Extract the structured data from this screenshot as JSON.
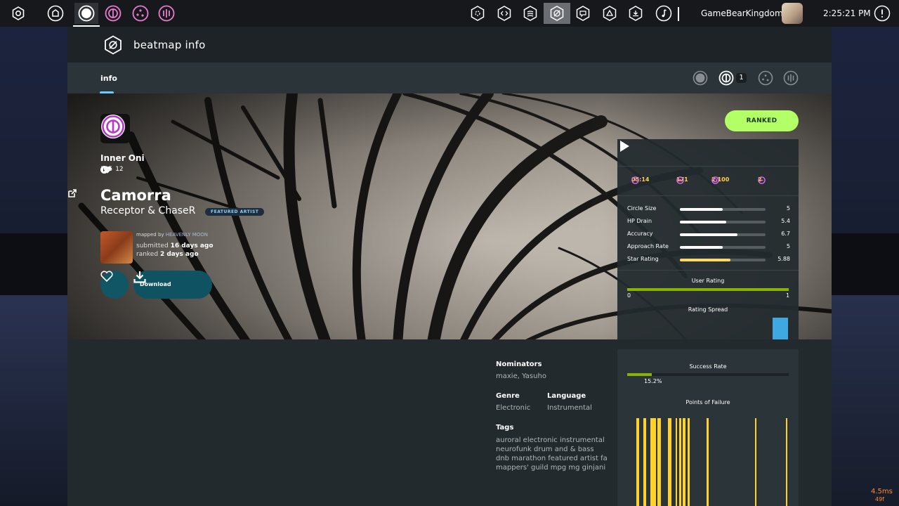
{
  "toolbar": {
    "user": "GameBearKingdom",
    "clock": "2:25:21 PM",
    "left_buttons": [
      "settings-icon",
      "home-icon",
      "osu-ruleset-icon",
      "taiko-ruleset-icon",
      "catch-ruleset-icon",
      "mania-ruleset-icon"
    ],
    "right_buttons": [
      "news-icon",
      "changelog-icon",
      "rankings-icon",
      "beatmap-listing-icon",
      "chat-icon",
      "notifications-icon",
      "wiki-icon",
      "music-icon"
    ]
  },
  "overlay": {
    "title": "beatmap info",
    "tab": "info",
    "ruleset_count": "1",
    "status": "RANKED"
  },
  "beatmap": {
    "difficulty_name": "Inner Oni",
    "play_count": "105",
    "favourite_count": "12",
    "title": "Camorra",
    "artist": "Receptor & ChaseR",
    "featured_label": "FEATURED ARTIST",
    "mapped_by_label": "mapped by",
    "mapper": "HEAVENLY MOON",
    "submitted_label": "submitted",
    "submitted_ago": "16 days ago",
    "ranked_label": "ranked",
    "ranked_ago": "2 days ago",
    "download_label": "Download"
  },
  "stats": {
    "length": "05:14",
    "bpm": "171",
    "circles": "2,100",
    "sliders": "2"
  },
  "attributes": [
    {
      "label": "Circle Size",
      "value": "5",
      "fraction": 0.5
    },
    {
      "label": "HP Drain",
      "value": "5.4",
      "fraction": 0.54
    },
    {
      "label": "Accuracy",
      "value": "6.7",
      "fraction": 0.67
    },
    {
      "label": "Approach Rate",
      "value": "5",
      "fraction": 0.5
    },
    {
      "label": "Star Rating",
      "value": "5.88",
      "fraction": 0.588
    }
  ],
  "user_rating": {
    "title": "User Rating",
    "min": "0",
    "max": "1",
    "spread_title": "Rating Spread"
  },
  "details": {
    "nominators_title": "Nominators",
    "nominators": "maxie, Yasuho",
    "genre_title": "Genre",
    "genre": "Electronic",
    "language_title": "Language",
    "language": "Instrumental",
    "tags_title": "Tags",
    "tags": "auroral electronic instrumental neurofunk drum and & bass dnb marathon featured artist fa mappers' guild mpg mg ginjani"
  },
  "success": {
    "title": "Success Rate",
    "rate_label": "15.2%",
    "rate": 0.152,
    "failure_title": "Points of Failure"
  },
  "perf": {
    "ms": "4.5ms",
    "fps": "49f"
  },
  "colors": {
    "accent": "#66ccff",
    "ranked": "#b2ff66",
    "stats": "#ffd24a",
    "failure": "#ffd22a"
  }
}
